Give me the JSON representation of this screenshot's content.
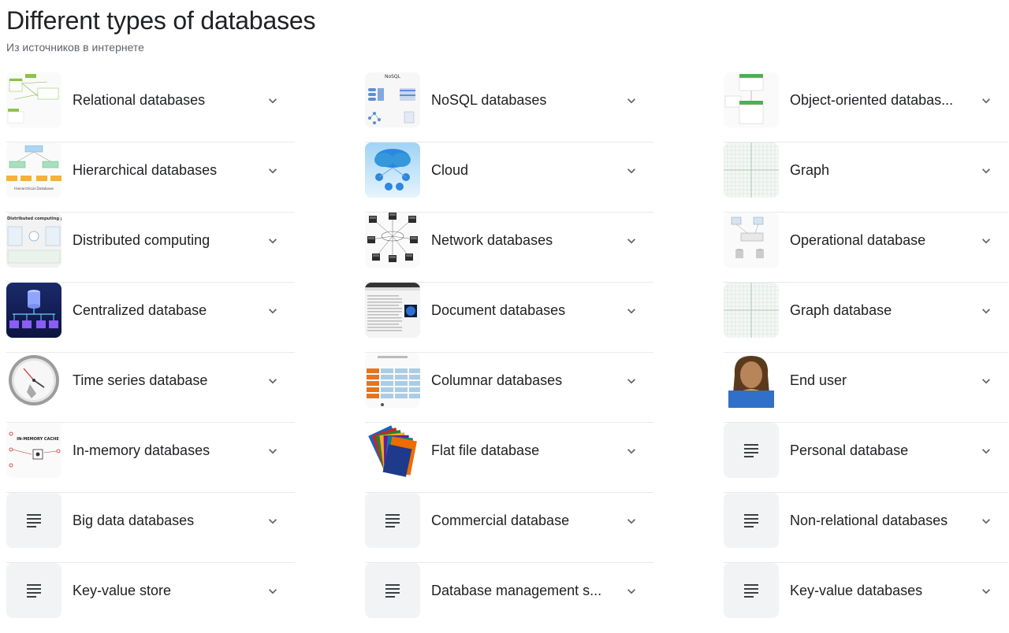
{
  "header": {
    "title": "Different types of databases",
    "subtitle": "Из источников в интернете"
  },
  "items": [
    {
      "label": "Relational databases",
      "thumb": "relational-diagram"
    },
    {
      "label": "NoSQL databases",
      "thumb": "nosql-diagram"
    },
    {
      "label": "Object-oriented databas...",
      "thumb": "object-oriented-diagram"
    },
    {
      "label": "Hierarchical databases",
      "thumb": "hierarchical-diagram"
    },
    {
      "label": "Cloud",
      "thumb": "cloud-computing"
    },
    {
      "label": "Graph",
      "thumb": "graph-grid"
    },
    {
      "label": "Distributed computing",
      "thumb": "distributed-diagram"
    },
    {
      "label": "Network databases",
      "thumb": "network-diagram"
    },
    {
      "label": "Operational database",
      "thumb": "operational-diagram"
    },
    {
      "label": "Centralized database",
      "thumb": "centralized-illustration"
    },
    {
      "label": "Document databases",
      "thumb": "document-screenshot"
    },
    {
      "label": "Graph database",
      "thumb": "graph-grid"
    },
    {
      "label": "Time series database",
      "thumb": "clock"
    },
    {
      "label": "Columnar databases",
      "thumb": "columnar-diagram"
    },
    {
      "label": "End user",
      "thumb": "person"
    },
    {
      "label": "In-memory databases",
      "thumb": "in-memory-diagram"
    },
    {
      "label": "Flat file database",
      "thumb": "file-folders"
    },
    {
      "label": "Personal database",
      "thumb": "text-lines-icon"
    },
    {
      "label": "Big data databases",
      "thumb": "text-lines-icon"
    },
    {
      "label": "Commercial database",
      "thumb": "text-lines-icon"
    },
    {
      "label": "Non-relational databases",
      "thumb": "text-lines-icon"
    },
    {
      "label": "Key-value store",
      "thumb": "text-lines-icon"
    },
    {
      "label": "Database management s...",
      "thumb": "text-lines-icon"
    },
    {
      "label": "Key-value databases",
      "thumb": "text-lines-icon"
    }
  ],
  "thumb_text": {
    "nosql_title": "NoSQL",
    "distributed_title": "Distributed computing pr",
    "hierarchical_caption": "Hierarchical Database",
    "in_memory_caption": "IN-MEMORY CACHE"
  },
  "colors": {
    "text": "#202124",
    "subtext": "#5f6368",
    "divider": "#e8eaed",
    "icon_bg": "#f1f3f4",
    "chevron": "#5f6368"
  }
}
